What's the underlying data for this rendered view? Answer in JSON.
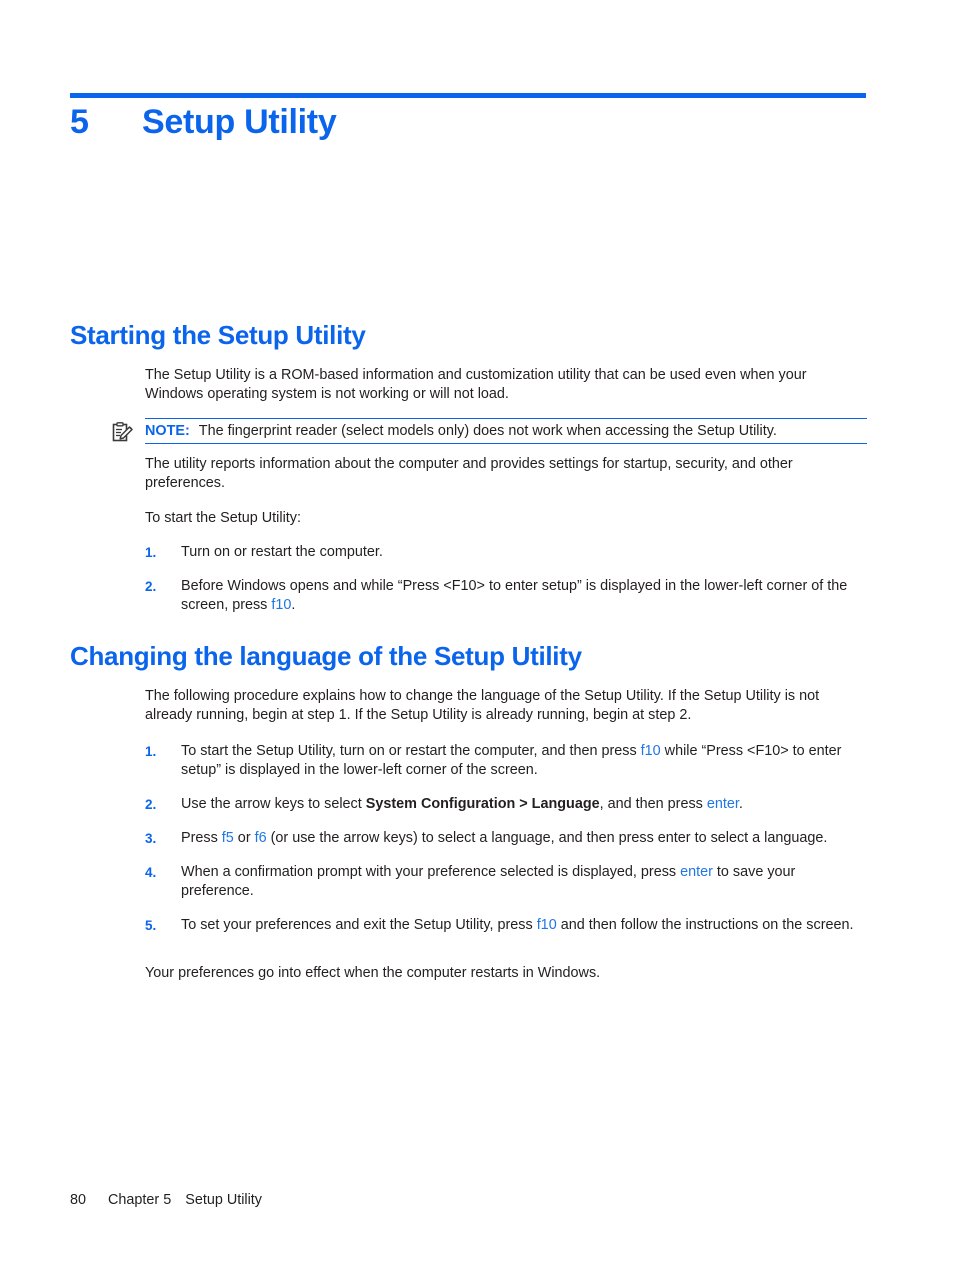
{
  "chapter": {
    "number": "5",
    "title": "Setup Utility"
  },
  "sections": {
    "starting": {
      "heading": "Starting the Setup Utility",
      "intro": "The Setup Utility is a ROM-based information and customization utility that can be used even when your Windows operating system is not working or will not load.",
      "note": {
        "icon": "note-clipboard-icon",
        "label": "NOTE:",
        "text": "The fingerprint reader (select models only) does not work when accessing the Setup Utility."
      },
      "reports": "The utility reports information about the computer and provides settings for startup, security, and other preferences.",
      "to_start": "To start the Setup Utility:",
      "steps": [
        {
          "marker": "1.",
          "parts": [
            {
              "t": "Turn on or restart the computer.",
              "style": "normal"
            }
          ]
        },
        {
          "marker": "2.",
          "parts": [
            {
              "t": "Before Windows opens and while “Press <F10> to enter setup” is displayed in the lower-left corner of the screen, press ",
              "style": "normal"
            },
            {
              "t": "f10",
              "style": "key"
            },
            {
              "t": ".",
              "style": "normal"
            }
          ]
        }
      ]
    },
    "changing_language": {
      "heading": "Changing the language of the Setup Utility",
      "intro": "The following procedure explains how to change the language of the Setup Utility. If the Setup Utility is not already running, begin at step 1. If the Setup Utility is already running, begin at step 2.",
      "steps": [
        {
          "marker": "1.",
          "parts": [
            {
              "t": "To start the Setup Utility, turn on or restart the computer, and then press ",
              "style": "normal"
            },
            {
              "t": "f10",
              "style": "key"
            },
            {
              "t": " while “Press <F10> to enter setup” is displayed in the lower-left corner of the screen.",
              "style": "normal"
            }
          ]
        },
        {
          "marker": "2.",
          "parts": [
            {
              "t": "Use the arrow keys to select ",
              "style": "normal"
            },
            {
              "t": "System Configuration > Language",
              "style": "bold"
            },
            {
              "t": ", and then press ",
              "style": "normal"
            },
            {
              "t": "enter",
              "style": "key"
            },
            {
              "t": ".",
              "style": "normal"
            }
          ]
        },
        {
          "marker": "3.",
          "parts": [
            {
              "t": "Press ",
              "style": "normal"
            },
            {
              "t": "f5",
              "style": "key"
            },
            {
              "t": " or ",
              "style": "normal"
            },
            {
              "t": "f6",
              "style": "key"
            },
            {
              "t": " (or use the arrow keys) to select a language, and then press enter to select a language.",
              "style": "normal"
            }
          ]
        },
        {
          "marker": "4.",
          "parts": [
            {
              "t": "When a confirmation prompt with your preference selected is displayed, press ",
              "style": "normal"
            },
            {
              "t": "enter",
              "style": "key"
            },
            {
              "t": " to save your preference.",
              "style": "normal"
            }
          ]
        },
        {
          "marker": "5.",
          "parts": [
            {
              "t": "To set your preferences and exit the Setup Utility, press ",
              "style": "normal"
            },
            {
              "t": "f10",
              "style": "key"
            },
            {
              "t": " and then follow the instructions on the screen.",
              "style": "normal"
            }
          ]
        }
      ],
      "closing": "Your preferences go into effect when the computer restarts in Windows."
    }
  },
  "footer": {
    "page_number": "80",
    "chapter_label": "Chapter 5",
    "chapter_title": "Setup Utility"
  },
  "colors": {
    "accent_blue": "#0a64ec",
    "key_blue": "#1f76e8",
    "body_black": "#231f20"
  }
}
